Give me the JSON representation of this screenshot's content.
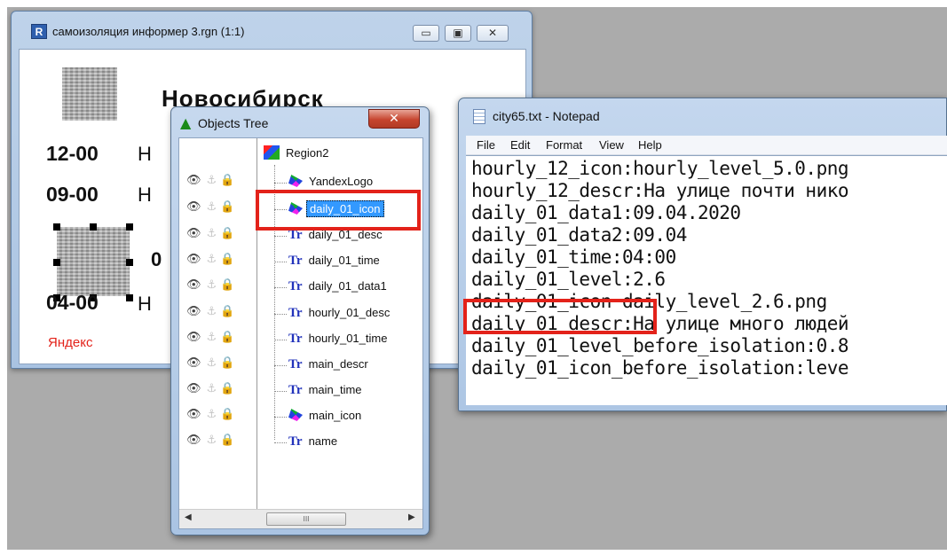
{
  "preview_window": {
    "title": "самоизоляция информер 3.rgn  (1:1)",
    "app_icon": "R",
    "minimize": "▭",
    "maximize": "▣",
    "close": "✕",
    "city": "Новосибирск",
    "times": [
      "12-00",
      "09-00",
      "04-00"
    ],
    "stubs": [
      "Н",
      "Н",
      "0",
      "Н"
    ],
    "brand": "Яндекс"
  },
  "objects_tree": {
    "title": "Objects Tree",
    "close": "✕",
    "root": "Region2",
    "items": [
      {
        "label": "YandexLogo",
        "icon": "object-icon"
      },
      {
        "label": "daily_01_icon",
        "icon": "object-icon",
        "selected": true
      },
      {
        "label": "daily_01_desc",
        "icon": "text-icon"
      },
      {
        "label": "daily_01_time",
        "icon": "text-icon"
      },
      {
        "label": "daily_01_data1",
        "icon": "text-icon"
      },
      {
        "label": "hourly_01_desc",
        "icon": "text-icon"
      },
      {
        "label": "hourly_01_time",
        "icon": "text-icon"
      },
      {
        "label": "main_descr",
        "icon": "text-icon"
      },
      {
        "label": "main_time",
        "icon": "text-icon"
      },
      {
        "label": "main_icon",
        "icon": "object-icon"
      },
      {
        "label": "name",
        "icon": "text-icon"
      }
    ],
    "row_icons": [
      "eye-icon",
      "anchor-icon",
      "lock-icon"
    ],
    "scroll_thumb": "III"
  },
  "notepad": {
    "title": "city65.txt - Notepad",
    "menu": [
      "File",
      "Edit",
      "Format",
      "View",
      "Help"
    ],
    "lines": [
      "hourly_12_icon:hourly_level_5.0.png",
      "hourly_12_descr:На улице почти нико",
      "daily_01_data1:09.04.2020",
      "daily_01_data2:09.04",
      "daily_01_time:04:00",
      "daily_01_level:2.6",
      "daily_01_icon daily_level_2.6.png",
      "daily_01_descr:На улице много людей",
      "daily_01_level_before_isolation:0.8",
      "daily_01_icon_before_isolation:leve"
    ]
  },
  "colors": {
    "highlight": "#e3221a",
    "selection": "#3399ff",
    "desktop": "#ababab"
  }
}
